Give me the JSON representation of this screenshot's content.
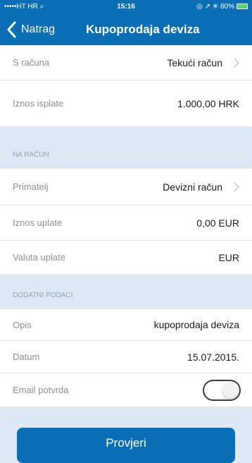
{
  "status_bar": {
    "carrier": "•••••HT HR ⌕",
    "time": "15:16",
    "indicators": "◎ ↗ ✳ 80%"
  },
  "nav": {
    "back_label": "Natrag",
    "title": "Kupoprodaja deviza"
  },
  "from_account": {
    "label": "S računa",
    "value": "Tekući račun"
  },
  "payout_amount": {
    "label": "Iznos isplate",
    "value": "1.000,00 HRK"
  },
  "section_to_account": "NA RAČUN",
  "recipient": {
    "label": "Primatelj",
    "value": "Devizni račun"
  },
  "payin_amount": {
    "label": "Iznos uplate",
    "value": "0,00 EUR"
  },
  "payin_currency": {
    "label": "Valuta uplate",
    "value": "EUR"
  },
  "section_additional": "DODATNI PODACI",
  "description": {
    "label": "Opis",
    "value": "kupoprodaja deviza"
  },
  "date": {
    "label": "Datum",
    "value": "15.07.2015."
  },
  "email_confirmation": {
    "label": "Email potvrda",
    "enabled": false
  },
  "check_button": "Provjeri",
  "colors": {
    "brand_blue": "#0a6eb4",
    "section_bg": "#dce9f4",
    "label_gray": "#8e8e93"
  },
  "icons": [
    "back-chevron-icon",
    "row-chevron-icon",
    "battery-icon"
  ]
}
